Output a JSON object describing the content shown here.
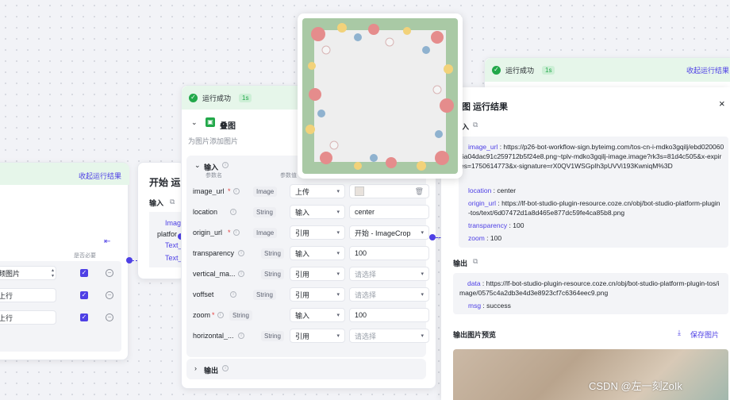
{
  "left_node": {
    "collapse_label": "收起运行结果",
    "col_label": "是否必要",
    "rows": [
      "频图片",
      "上行",
      "上行"
    ]
  },
  "start_node": {
    "title": "开始 运",
    "input_label": "输入",
    "frag_image": "Imag",
    "frag_platform": "platfor",
    "frag_text1": "Text_",
    "frag_text2": "Text_"
  },
  "overlay_node": {
    "status": "运行成功",
    "time": "1s",
    "title": "叠图",
    "desc": "为图片添加图片",
    "input_section": "输入",
    "col_name": "参数名",
    "col_value": "参数值",
    "params": [
      {
        "name": "image_url",
        "required": true,
        "type": "Image",
        "mode": "上传",
        "value": "",
        "kind": "upload"
      },
      {
        "name": "location",
        "required": false,
        "type": "String",
        "mode": "输入",
        "value": "center",
        "kind": "text"
      },
      {
        "name": "origin_url",
        "required": true,
        "type": "Image",
        "mode": "引用",
        "value": "开始 - ImageCrop",
        "kind": "ref"
      },
      {
        "name": "transparency",
        "required": false,
        "type": "String",
        "mode": "输入",
        "value": "100",
        "kind": "text"
      },
      {
        "name": "vertical_ma...",
        "required": false,
        "type": "String",
        "mode": "引用",
        "value": "请选择",
        "kind": "ph"
      },
      {
        "name": "voffset",
        "required": false,
        "type": "String",
        "mode": "引用",
        "value": "请选择",
        "kind": "ph"
      },
      {
        "name": "zoom",
        "required": true,
        "type": "String",
        "mode": "输入",
        "value": "100",
        "kind": "text"
      },
      {
        "name": "horizontal_...",
        "required": false,
        "type": "String",
        "mode": "引用",
        "value": "请选择",
        "kind": "ph"
      }
    ],
    "output_section": "输出"
  },
  "right_node": {
    "status": "运行成功",
    "time": "1s",
    "collapse_label": "收起运行结果"
  },
  "result_panel": {
    "title": "图 运行结果",
    "close": "×",
    "input_label": "入",
    "image_url_key": "image_url",
    "image_url_val": "https://p26-bot-workflow-sign.byteimg.com/tos-cn-i-mdko3gqilj/ebd0200606a04dac91c259712b5f24e8.png~tplv-mdko3gqilj-image.image?rk3s=81d4c505&x-expires=1750614773&x-signature=rX0QV1WSGpIh3pUVVi193KwniqM%3D",
    "location_key": "location",
    "location_val": "center",
    "origin_url_key": "origin_url",
    "origin_url_val": "https://lf-bot-studio-plugin-resource.coze.cn/obj/bot-studio-platform-plugin-tos/text/6d07472d1a8d465e877dc59fe4ca85b8.png",
    "transparency_key": "transparency",
    "transparency_val": "100",
    "zoom_key": "zoom",
    "zoom_val": "100",
    "output_label": "输出",
    "data_key": "data",
    "data_val": "https://lf-bot-studio-plugin-resource.coze.cn/obj/bot-studio-platform-plugin-tos/image/0575c4a2db3e4d3e8923cf7c6364eec9.png",
    "msg_key": "msg",
    "msg_val": "success",
    "preview_label": "输出图片预览",
    "save_label": "保存图片"
  },
  "watermark": "CSDN @左一刻ZoIk",
  "colors": {
    "accent": "#4e40e5",
    "success": "#22a84a",
    "success_bg": "#e6f6ea"
  }
}
